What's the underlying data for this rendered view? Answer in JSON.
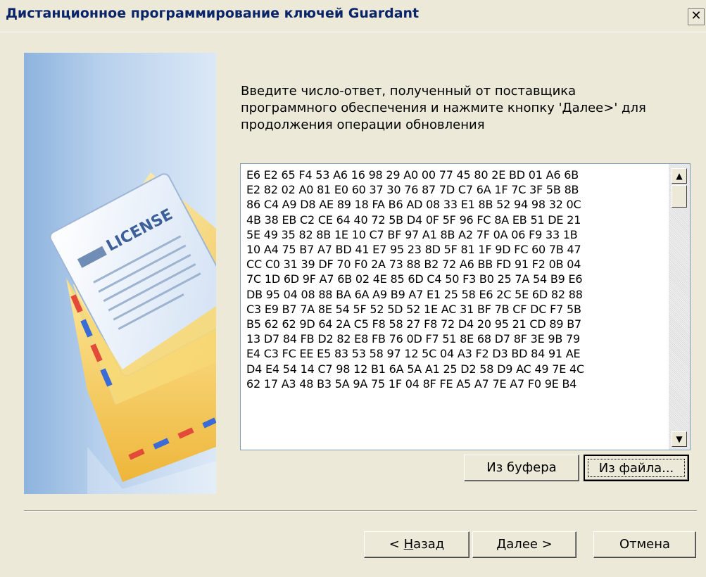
{
  "window": {
    "title": "Дистанционное программирование ключей Guardant"
  },
  "sidebar": {
    "license_label": "LICENSE"
  },
  "instructions": "Введите число-ответ, полученный от поставщика\nпрограммного обеспечения и нажмите кнопку 'Далее>' для\nпродолжения операции обновления",
  "code_lines": [
    "E6 E2 65 F4 53 A6 16 98 29 A0 00 77 45 80 2E BD 01 A6 6B",
    "E2 82 02 A0 81 E0 60 37 30 76 87 7D C7 6A 1F 7C 3F 5B 8B",
    "86 C4 A9 D8 AE 89 18 FA B6 AD 08 33 E1 8B 52 94 98 32 0C",
    "4B 38 EB C2 CE 64 40 72 5B D4 0F 5F 96 FC 8A EB 51 DE 21",
    "5E 49 35 82 8B 1E 10 C7 BF 97 A1 8B A2 7F 0A 06 F9 33 1B",
    "10 A4 75 B7 A7 BD 41 E7 95 23 8D 5F 81 1F 9D FC 60 7B 47",
    "CC C0 31 39 DF 70 F0 2A 73 88 B2 72 A6 BB FD 91 F2 0B 04",
    "7C 1D 6D 9F A7 6B 02 4E 85 6D C4 50 F3 B0 25 7A 54 B9 E6",
    "DB 95 04 08 88 BA 6A A9 B9 A7 E1 25 58 E6 2C 5E 6D 82 88",
    "C3 E9 B7 7A 8E 54 5F 52 5D 52 1E AC 31 BF 7B CF DC F7 5B",
    "B5 62 62 9D 64 2A C5 F8 58 27 F8 72 D4 20 95 21 CD 89 B7",
    "13 D7 84 FB D2 82 E8 FB 76 0D F7 51 8E 68 D7 8F 3E 9B 79",
    "E4 C3 FC EE E5 83 53 58 97 12 5C 04 A3 F2 D3 BD 84 91 AE",
    "D4 E4 54 14 C7 98 12 B1 6A 5A A1 25 D2 58 D9 AC 49 7E 4C",
    "62 17 A3 48 B3 5A 9A 75 1F 04 8F FE A5 A7 7E A7 F0 9E B4"
  ],
  "buttons": {
    "from_buffer": "Из буфера",
    "from_file": "Из файла...",
    "back_prefix": "< ",
    "back_hotkey": "Н",
    "back_rest": "азад",
    "next_hotkey": "Д",
    "next_rest": "алее >",
    "cancel": "Отмена"
  }
}
